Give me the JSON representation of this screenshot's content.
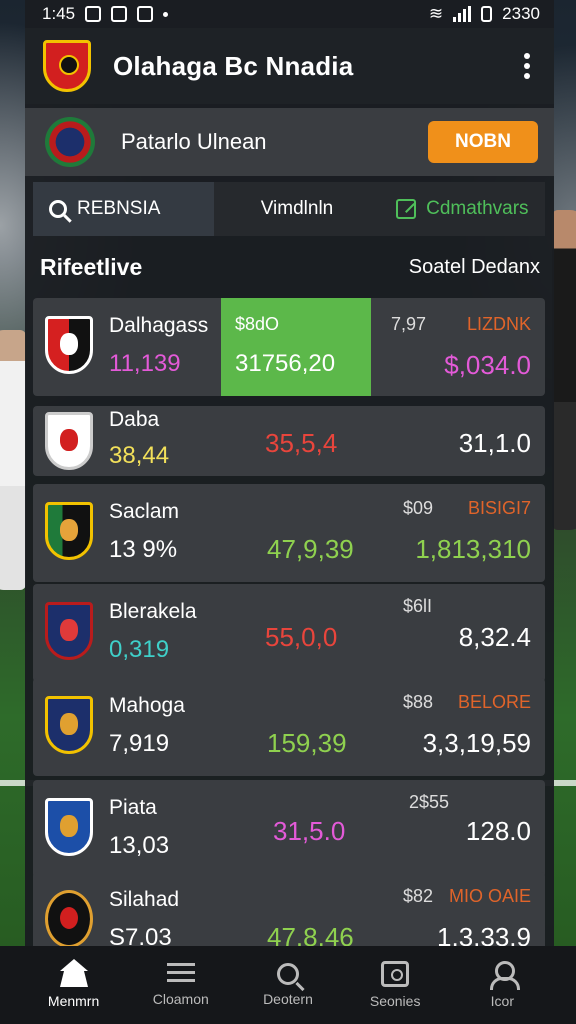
{
  "status_bar": {
    "time": "1:45",
    "battery": "2330"
  },
  "header": {
    "title": "Olahaga Bc Nnadia"
  },
  "team_bar": {
    "team_name": "Patarlo Ulnean",
    "action_label": "NOBN"
  },
  "tabs": [
    {
      "label": "REBNSIA",
      "icon": "search-icon",
      "active": true
    },
    {
      "label": "Vimdlnln",
      "active": false
    },
    {
      "label": "Cdmathvars",
      "icon": "edit-icon",
      "active": false
    }
  ],
  "section": {
    "title": "Rifeetlive",
    "link": "Soatel Dedanx"
  },
  "rows": [
    {
      "name": "Dalhagass",
      "sub": "11,139",
      "highlight_top": "$8dO",
      "highlight_value": "31756,20",
      "small": "7,97",
      "tag": "LIZDNK",
      "right_value": "$,034.0"
    },
    {
      "name": "Daba",
      "sub": "38,44",
      "mid_value": "35,5,4",
      "right_value": "31,1.0"
    },
    {
      "name": "Saclam",
      "sub": "13 9%",
      "small": "$09",
      "tag": "BISIGI7",
      "mid_value": "47,9,39",
      "right_value": "1,813,310"
    },
    {
      "name": "Blerakela",
      "sub": "0,319",
      "small": "$6lI",
      "mid_value": "55,0,0",
      "right_value": "8,32.4"
    },
    {
      "name": "Mahoga",
      "sub": "7,919",
      "small": "$88",
      "tag": "BELORE",
      "mid_value": "159,39",
      "right_value": "3,3,19,59"
    },
    {
      "name": "Piata",
      "sub": "13,03",
      "small": "2$55",
      "mid_value": "31,5.0",
      "right_value": "128.0"
    },
    {
      "name": "Silahad",
      "sub": "S7.03",
      "small": "$82",
      "tag": "MIO OAIE",
      "mid_value": "47.8.46",
      "right_value": "1,3,33.9"
    }
  ],
  "nav": [
    {
      "label": "Menmrn",
      "icon": "home-icon",
      "active": true
    },
    {
      "label": "Cloamon",
      "icon": "list-icon",
      "active": false
    },
    {
      "label": "Deotern",
      "icon": "search-icon",
      "active": false
    },
    {
      "label": "Seonies",
      "icon": "photo-icon",
      "active": false
    },
    {
      "label": "Icor",
      "icon": "user-icon",
      "active": false
    }
  ],
  "colors": {
    "accent_orange": "#f0901a",
    "highlight_green": "#5cb84a",
    "value_green": "#8fd14f",
    "value_red": "#e8453c",
    "value_pink": "#e35ad8",
    "value_teal": "#3fd0c9",
    "tag_orange": "#e0642a"
  }
}
